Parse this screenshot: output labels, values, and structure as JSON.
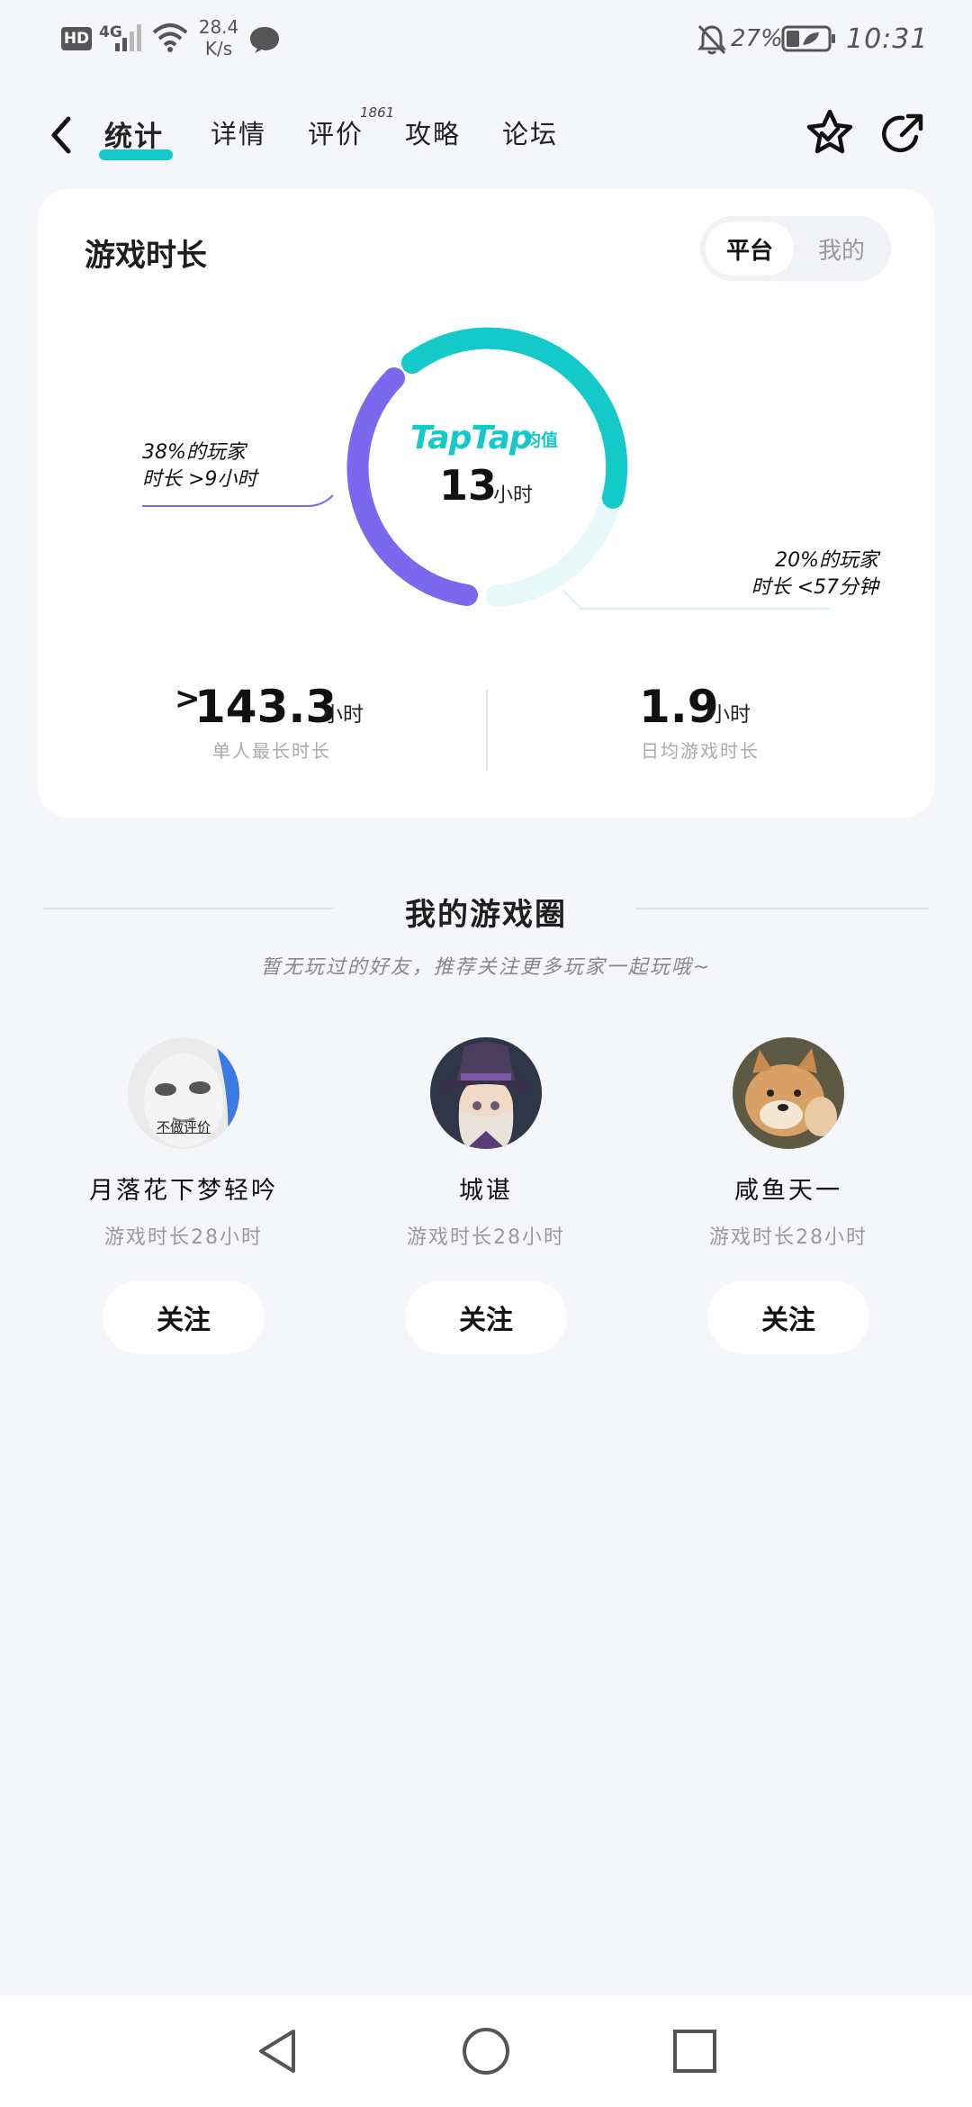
{
  "status_bar": {
    "hd": "HD",
    "network": "4G",
    "speed_value": "28.4",
    "speed_unit": "K/s",
    "battery": "27%",
    "time": "10:31"
  },
  "nav": {
    "tabs": [
      {
        "label": "统计",
        "active": true
      },
      {
        "label": "详情"
      },
      {
        "label": "评价",
        "badge": "1861"
      },
      {
        "label": "攻略"
      },
      {
        "label": "论坛"
      }
    ]
  },
  "stats": {
    "title": "游戏时长",
    "toggle": [
      "平台",
      "我的"
    ],
    "brand": "TapTap",
    "brand_sub": "均值",
    "average_value": "13",
    "average_unit": "小时",
    "annotation_left": [
      "38%的玩家",
      "时长 >9小时"
    ],
    "annotation_right": [
      "20%的玩家",
      "时长 <57分钟"
    ],
    "max_prefix": ">",
    "max_value": "143.3",
    "max_unit": "小时",
    "max_label": "单人最长时长",
    "daily_value": "1.9",
    "daily_unit": "小时",
    "daily_label": "日均游戏时长",
    "colors": {
      "teal": "#14c9c9",
      "purple": "#7b68ee",
      "light": "#e6f8f7"
    }
  },
  "game_circle": {
    "title": "我的游戏圈",
    "subtitle": "暂无玩过的好友，推荐关注更多玩家一起玩哦~",
    "users": [
      {
        "name": "月落花下梦轻吟",
        "hours": "游戏时长28小时",
        "follow": "关注",
        "avatar_caption": "不做评价"
      },
      {
        "name": "城谌",
        "hours": "游戏时长28小时",
        "follow": "关注"
      },
      {
        "name": "咸鱼天一",
        "hours": "游戏时长28小时",
        "follow": "关注"
      }
    ]
  }
}
